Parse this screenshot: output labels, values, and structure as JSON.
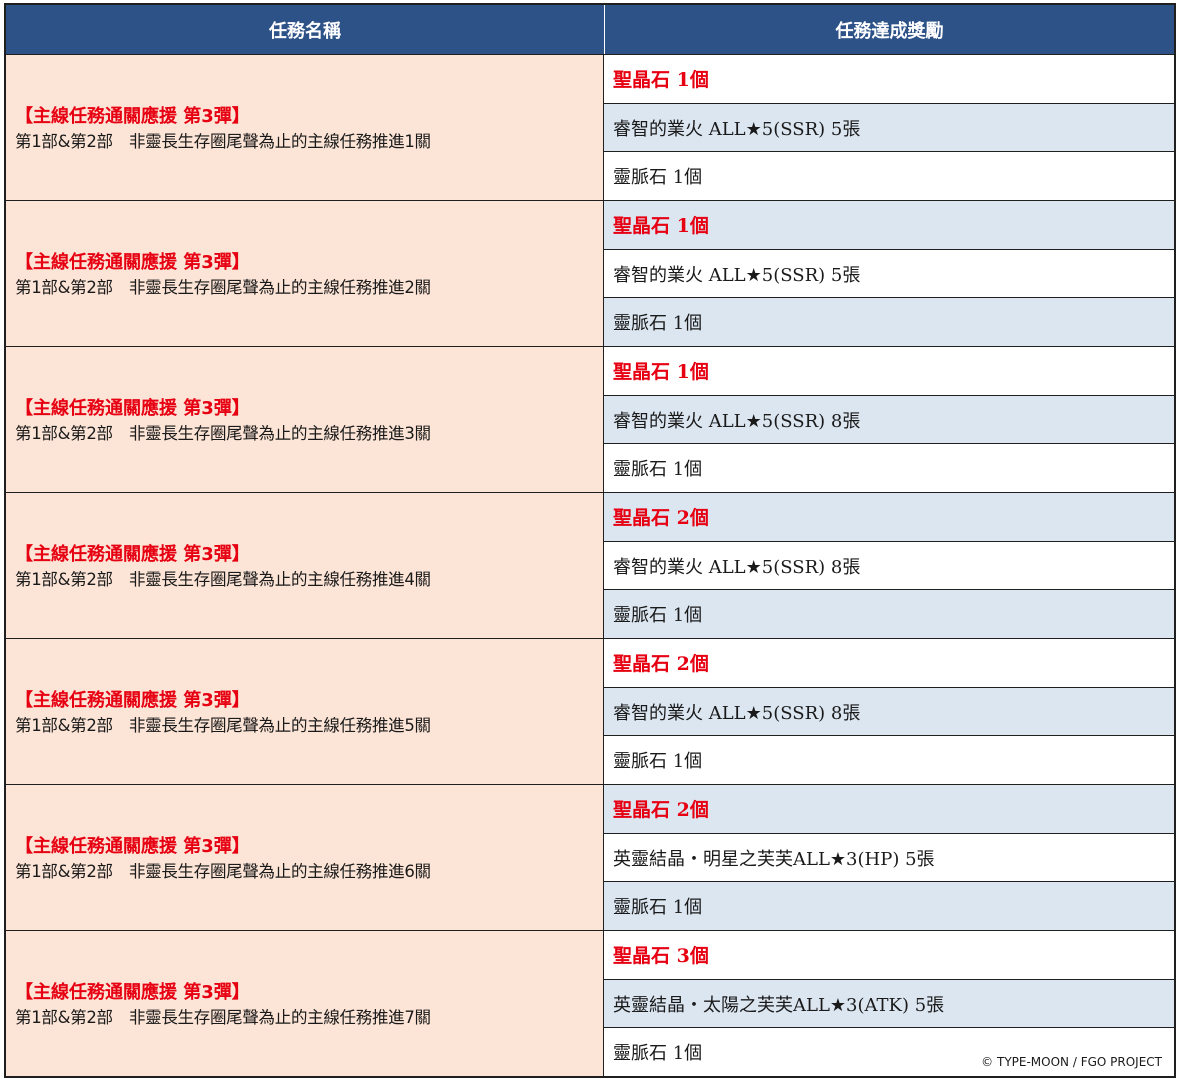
{
  "header": {
    "col1": "任務名稱",
    "col2": "任務達成獎勵"
  },
  "missions": [
    {
      "title": "【主線任務通關應援 第3彈】",
      "desc": "第1部&第2部　非靈長生存圈尾聲為止的主線任務推進1關",
      "rewards": [
        "聖晶石 1個",
        "睿智的業火 ALL★5(SSR) 5張",
        "靈脈石 1個"
      ]
    },
    {
      "title": "【主線任務通關應援 第3彈】",
      "desc": "第1部&第2部　非靈長生存圈尾聲為止的主線任務推進2關",
      "rewards": [
        "聖晶石 1個",
        "睿智的業火 ALL★5(SSR) 5張",
        "靈脈石 1個"
      ]
    },
    {
      "title": "【主線任務通關應援 第3彈】",
      "desc": "第1部&第2部　非靈長生存圈尾聲為止的主線任務推進3關",
      "rewards": [
        "聖晶石 1個",
        "睿智的業火 ALL★5(SSR) 8張",
        "靈脈石 1個"
      ]
    },
    {
      "title": "【主線任務通關應援 第3彈】",
      "desc": "第1部&第2部　非靈長生存圈尾聲為止的主線任務推進4關",
      "rewards": [
        "聖晶石 2個",
        "睿智的業火 ALL★5(SSR) 8張",
        "靈脈石 1個"
      ]
    },
    {
      "title": "【主線任務通關應援 第3彈】",
      "desc": "第1部&第2部　非靈長生存圈尾聲為止的主線任務推進5關",
      "rewards": [
        "聖晶石 2個",
        "睿智的業火 ALL★5(SSR) 8張",
        "靈脈石 1個"
      ]
    },
    {
      "title": "【主線任務通關應援 第3彈】",
      "desc": "第1部&第2部　非靈長生存圈尾聲為止的主線任務推進6關",
      "rewards": [
        "聖晶石 2個",
        "英靈結晶・明星之芙芙ALL★3(HP) 5張",
        "靈脈石 1個"
      ]
    },
    {
      "title": "【主線任務通關應援 第3彈】",
      "desc": "第1部&第2部　非靈長生存圈尾聲為止的主線任務推進7關",
      "rewards": [
        "聖晶石 3個",
        "英靈結晶・太陽之芙芙ALL★3(ATK) 5張",
        "靈脈石 1個"
      ]
    }
  ],
  "copyright": "© TYPE-MOON / FGO PROJECT",
  "colors": {
    "header_bg": "#2d5287",
    "mission_bg": "#fce4d6",
    "alt_row_bg": "#dce6f1",
    "highlight_red": "#e60012"
  }
}
